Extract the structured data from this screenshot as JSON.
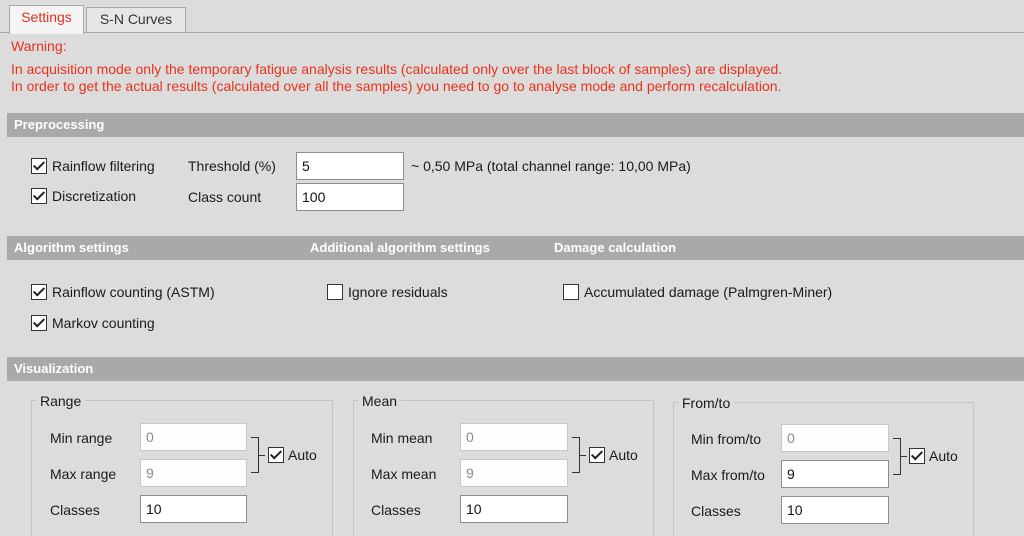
{
  "tabs": [
    {
      "label": "Settings",
      "active": true
    },
    {
      "label": "S-N Curves",
      "active": false
    }
  ],
  "warning": {
    "title": "Warning:",
    "line1": "In acquisition mode only the temporary fatigue analysis results (calculated only over the last block of samples) are displayed.",
    "line2": "In order to get the actual results (calculated over all the samples) you need to go to analyse mode and perform recalculation."
  },
  "colors": {
    "warning": "#e8321c",
    "section_bar": "#a9a9a9",
    "background": "#dcdcdc"
  },
  "preprocessing": {
    "title": "Preprocessing",
    "rainflow_filtering": {
      "label": "Rainflow filtering",
      "checked": true
    },
    "discretization": {
      "label": "Discretization",
      "checked": true
    },
    "threshold": {
      "label": "Threshold (%)",
      "value": "5",
      "note": "~ 0,50 MPa (total channel range: 10,00 MPa)"
    },
    "class_count": {
      "label": "Class count",
      "value": "100"
    }
  },
  "algorithm": {
    "title": "Algorithm settings",
    "additional_title": "Additional algorithm settings",
    "damage_title": "Damage calculation",
    "rainflow_counting": {
      "label": "Rainflow counting (ASTM)",
      "checked": true
    },
    "markov_counting": {
      "label": "Markov counting",
      "checked": true
    },
    "ignore_residuals": {
      "label": "Ignore residuals",
      "checked": false
    },
    "accumulated_damage": {
      "label": "Accumulated damage (Palmgren-Miner)",
      "checked": false
    }
  },
  "visualization": {
    "title": "Visualization",
    "range": {
      "title": "Range",
      "min_label": "Min range",
      "min_value": "0",
      "max_label": "Max range",
      "max_value": "9",
      "classes_label": "Classes",
      "classes_value": "10",
      "auto_label": "Auto",
      "auto_checked": true
    },
    "mean": {
      "title": "Mean",
      "min_label": "Min mean",
      "min_value": "0",
      "max_label": "Max mean",
      "max_value": "9",
      "classes_label": "Classes",
      "classes_value": "10",
      "auto_label": "Auto",
      "auto_checked": true
    },
    "fromto": {
      "title": "From/to",
      "min_label": "Min from/to",
      "min_value": "0",
      "max_label": "Max from/to",
      "max_value": "9",
      "classes_label": "Classes",
      "classes_value": "10",
      "auto_label": "Auto",
      "auto_checked": true
    }
  }
}
